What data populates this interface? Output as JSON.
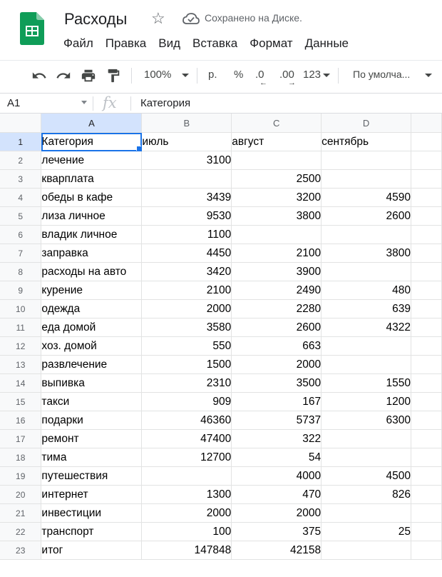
{
  "app": {
    "doc_title": "Расходы",
    "save_status": "Сохранено на Диске.",
    "icons": {
      "logo": "google-sheets-logo",
      "star": "star-icon",
      "cloud": "cloud-done-icon"
    },
    "colors": {
      "accent": "#1a73e8",
      "logo_green": "#0f9d58"
    }
  },
  "menu": [
    "Файл",
    "Правка",
    "Вид",
    "Вставка",
    "Формат",
    "Данные"
  ],
  "toolbar": {
    "zoom": "100%",
    "currency_format": "р.",
    "percent_format": "%",
    "decrease_decimals": ".0",
    "increase_decimals": ".00",
    "more_formats": "123",
    "font": "По умолча..."
  },
  "formula_bar": {
    "cell_ref": "A1",
    "fx_label": "fx",
    "value": "Категория"
  },
  "grid": {
    "columns": [
      "A",
      "B",
      "C",
      "D"
    ],
    "selected_cell": "A1",
    "rows": [
      {
        "n": "1",
        "a": "Категория",
        "b": "июль",
        "c": "август",
        "d": "сентябрь"
      },
      {
        "n": "2",
        "a": "лечение",
        "b": "3100",
        "c": "",
        "d": ""
      },
      {
        "n": "3",
        "a": "кварплата",
        "b": "",
        "c": "2500",
        "d": ""
      },
      {
        "n": "4",
        "a": "обеды в кафе",
        "b": "3439",
        "c": "3200",
        "d": "4590"
      },
      {
        "n": "5",
        "a": "лиза личное",
        "b": "9530",
        "c": "3800",
        "d": "2600"
      },
      {
        "n": "6",
        "a": "владик личное",
        "b": "1100",
        "c": "",
        "d": ""
      },
      {
        "n": "7",
        "a": "заправка",
        "b": "4450",
        "c": "2100",
        "d": "3800"
      },
      {
        "n": "8",
        "a": "расходы на авто",
        "b": "3420",
        "c": "3900",
        "d": ""
      },
      {
        "n": "9",
        "a": "курение",
        "b": "2100",
        "c": "2490",
        "d": "480"
      },
      {
        "n": "10",
        "a": "одежда",
        "b": "2000",
        "c": "2280",
        "d": "639"
      },
      {
        "n": "11",
        "a": "еда домой",
        "b": "3580",
        "c": "2600",
        "d": "4322"
      },
      {
        "n": "12",
        "a": "хоз. домой",
        "b": "550",
        "c": "663",
        "d": ""
      },
      {
        "n": "13",
        "a": "развлечение",
        "b": "1500",
        "c": "2000",
        "d": ""
      },
      {
        "n": "14",
        "a": "выпивка",
        "b": "2310",
        "c": "3500",
        "d": "1550"
      },
      {
        "n": "15",
        "a": "такси",
        "b": "909",
        "c": "167",
        "d": "1200"
      },
      {
        "n": "16",
        "a": "подарки",
        "b": "46360",
        "c": "5737",
        "d": "6300"
      },
      {
        "n": "17",
        "a": "ремонт",
        "b": "47400",
        "c": "322",
        "d": ""
      },
      {
        "n": "18",
        "a": "тима",
        "b": "12700",
        "c": "54",
        "d": ""
      },
      {
        "n": "19",
        "a": "путешествия",
        "b": "",
        "c": "4000",
        "d": "4500"
      },
      {
        "n": "20",
        "a": "интернет",
        "b": "1300",
        "c": "470",
        "d": "826"
      },
      {
        "n": "21",
        "a": "инвестиции",
        "b": "2000",
        "c": "2000",
        "d": ""
      },
      {
        "n": "22",
        "a": "транспорт",
        "b": "100",
        "c": "375",
        "d": "25"
      },
      {
        "n": "23",
        "a": "итог",
        "b": "147848",
        "c": "42158",
        "d": ""
      }
    ]
  }
}
